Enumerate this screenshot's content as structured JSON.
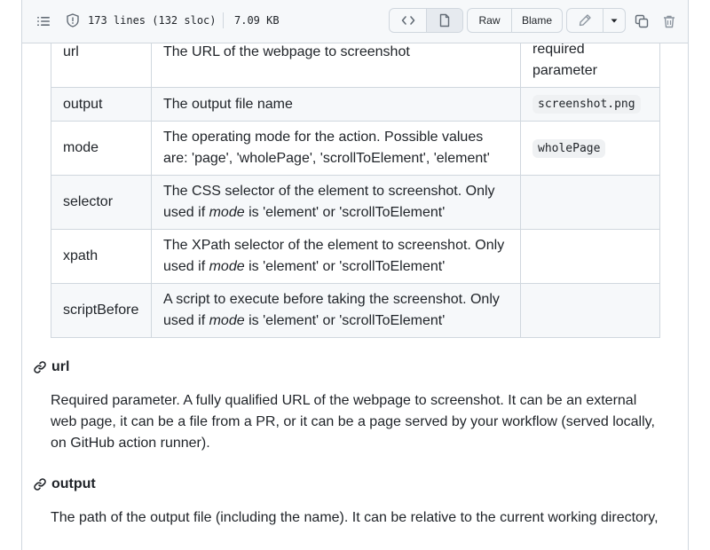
{
  "file_header": {
    "lines": "173 lines (132 sloc)",
    "size": "7.09 KB",
    "raw_label": "Raw",
    "blame_label": "Blame",
    "icons": [
      "list-icon",
      "shield-icon",
      "code-icon",
      "file-icon",
      "pencil-icon",
      "caret-down-icon",
      "copy-icon",
      "trash-icon"
    ]
  },
  "table": {
    "rows": [
      {
        "name": "url",
        "description": "The URL of the webpage to screenshot",
        "default": "required parameter"
      },
      {
        "name": "output",
        "description": "The output file name",
        "default_code": "screenshot.png"
      },
      {
        "name": "mode",
        "description": "The operating mode for the action. Possible values are: 'page', 'wholePage', 'scrollToElement', 'element'",
        "default_code": "wholePage"
      },
      {
        "name": "selector",
        "description_pre": "The CSS selector of the element to screenshot. Only used if ",
        "description_em": "mode",
        "description_post": " is 'element' or 'scrollToElement'"
      },
      {
        "name": "xpath",
        "description_pre": "The XPath selector of the element to screenshot. Only used if ",
        "description_em": "mode",
        "description_post": " is 'element' or 'scrollToElement'"
      },
      {
        "name": "scriptBefore",
        "description_pre": "A script to execute before taking the screenshot. Only used if ",
        "description_em": "mode",
        "description_post": " is 'element' or 'scrollToElement'"
      }
    ]
  },
  "sections": [
    {
      "heading": "url",
      "body": "Required parameter. A fully qualified URL of the webpage to screenshot. It can be an external web page, it can be a file from a PR, or it can be a page served by your workflow (served locally, on GitHub action runner)."
    },
    {
      "heading": "output",
      "body": "The path of the output file (including the name). It can be relative to the current working directory,"
    }
  ]
}
